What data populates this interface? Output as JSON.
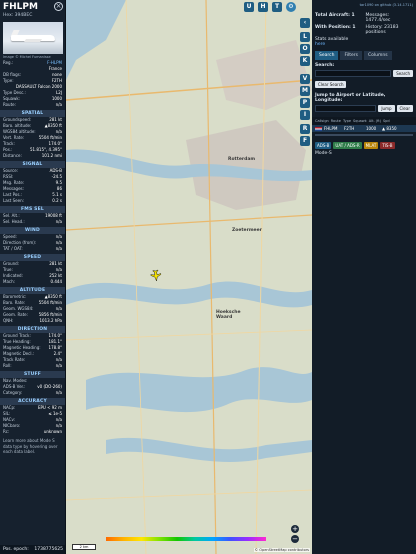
{
  "sidebar": {
    "callsign": "FHLPM",
    "subtitle": "Hex: 394BEC",
    "photo_credit": "Image © Michel Fumanisse",
    "aircraft": [
      {
        "k": "Reg.:",
        "v": "F-HLPM",
        "link": true
      },
      {
        "k": "",
        "v": "France"
      },
      {
        "k": "DB flags:",
        "v": "none"
      },
      {
        "k": "Type:",
        "v": "F2TH"
      },
      {
        "k": "",
        "v": "DASSAULT Falcon 2000"
      },
      {
        "k": "Type Desc.:",
        "v": "L2J"
      },
      {
        "k": "Squawk:",
        "v": "1000"
      },
      {
        "k": "Route:",
        "v": "n/a"
      }
    ],
    "sections": [
      {
        "title": "SPATIAL",
        "rows": [
          {
            "k": "Groundspeed:",
            "v": "281 kt"
          },
          {
            "k": "Baro. altitude:",
            "v": "▲8350 ft"
          },
          {
            "k": "WGS84 altitude:",
            "v": "n/a"
          },
          {
            "k": "Vert. Rate:",
            "v": "5504 ft/min"
          },
          {
            "k": "Track:",
            "v": "174.0°"
          },
          {
            "k": "Pos.:",
            "v": "51.815°, 4.395°"
          },
          {
            "k": "Distance:",
            "v": "101.2 nmi"
          }
        ]
      },
      {
        "title": "SIGNAL",
        "rows": [
          {
            "k": "Source:",
            "v": "ADS-B"
          },
          {
            "k": "RSSI:",
            "v": "-24.5"
          },
          {
            "k": "Msg. Rate:",
            "v": "9.5"
          },
          {
            "k": "Messages:",
            "v": "86"
          },
          {
            "k": "Last Pos.:",
            "v": "5.1 s"
          },
          {
            "k": "Last Seen:",
            "v": "0.2 s"
          }
        ]
      },
      {
        "title": "FMS SEL",
        "rows": [
          {
            "k": "Sel. Alt.:",
            "v": "19008 ft"
          },
          {
            "k": "Sel. Head.:",
            "v": "n/a"
          }
        ]
      },
      {
        "title": "WIND",
        "rows": [
          {
            "k": "Speed:",
            "v": "n/a"
          },
          {
            "k": "Direction (from):",
            "v": "n/a"
          },
          {
            "k": "TAT / OAT:",
            "v": "n/a"
          }
        ]
      },
      {
        "title": "SPEED",
        "rows": [
          {
            "k": "Ground:",
            "v": "281 kt"
          },
          {
            "k": "True:",
            "v": "n/a"
          },
          {
            "k": "Indicated:",
            "v": "252 kt"
          },
          {
            "k": "Mach:",
            "v": "0.444"
          }
        ]
      },
      {
        "title": "ALTITUDE",
        "rows": [
          {
            "k": "Barometric:",
            "v": "▲8350 ft"
          },
          {
            "k": "Baro. Rate:",
            "v": "5504 ft/min"
          },
          {
            "k": "Geom. WGS84:",
            "v": "n/a"
          },
          {
            "k": "Geom. Rate:",
            "v": "5856 ft/min"
          },
          {
            "k": "QNH:",
            "v": "1013.2 hPa"
          }
        ]
      },
      {
        "title": "DIRECTION",
        "rows": [
          {
            "k": "Ground Track:",
            "v": "174.0°"
          },
          {
            "k": "True Heading:",
            "v": "181.1°"
          },
          {
            "k": "Magnetic Heading:",
            "v": "178.8°"
          },
          {
            "k": "Magnetic Decl.:",
            "v": "2.4°"
          },
          {
            "k": "Track Rate:",
            "v": "n/a"
          },
          {
            "k": "Roll:",
            "v": "n/a"
          }
        ]
      },
      {
        "title": "STUFF",
        "rows": [
          {
            "k": "Nav. Modes:",
            "v": ""
          },
          {
            "k": "ADS-B Ver.:",
            "v": "v0 (DO-260)"
          },
          {
            "k": "Category:",
            "v": "n/a"
          }
        ]
      },
      {
        "title": "ACCURACY",
        "rows": [
          {
            "k": "NACp:",
            "v": "EPU < 92 m"
          },
          {
            "k": "SIL:",
            "v": "≤ 1e-5"
          },
          {
            "k": "NACv:",
            "v": "n/a"
          },
          {
            "k": "NICbaro:",
            "v": "n/a"
          },
          {
            "k": "Rc:",
            "v": "unknown"
          }
        ]
      }
    ],
    "note": "Learn more about Mode S data type by hovering over each data label.",
    "epoch_label": "Pos. epoch:",
    "epoch_value": "1738775625"
  },
  "map": {
    "controls_top": [
      "U",
      "H",
      "T"
    ],
    "controls_side": [
      "L",
      "O",
      "K",
      "V",
      "M",
      "P",
      "I",
      "R",
      "F"
    ],
    "places": [
      "Rotterdam",
      "Zoetermeer",
      "Hoeksche Waard",
      "Dordrecht"
    ],
    "scale_label": "2 km",
    "attribution": "© OpenStreetMap contributors",
    "zoom_in": "+",
    "zoom_out": "−"
  },
  "panel": {
    "version_link": "tar1090 on github (3.14.1711)",
    "stats": {
      "total_label": "Total Aircraft: 1",
      "messages_label": "Messages: 1477.4/sec",
      "position_label": "With Position: 1",
      "history_label": "History: 23183 positions"
    },
    "stats_link": "Stats available",
    "stats_link2": "here",
    "tabs": [
      "Search",
      "Filters",
      "Columns"
    ],
    "search_label": "Search:",
    "search_button": "Search",
    "clear_button": "Clear Search",
    "jump_label": "Jump to Airport or Latitude, Longitude:",
    "jump_button": "Jump",
    "jump_clear": "Clear",
    "table_headers": [
      "Callsign",
      "Route",
      "Type",
      "Squawk",
      "Alt. (ft)",
      "Spd"
    ],
    "table_row": {
      "callsign": "FHLPM",
      "type": "F2TH",
      "squawk": "1000",
      "alt": "▲ 8350"
    },
    "badges": [
      "ADS-B",
      "UAT / ADS-R",
      "MLAT",
      "TIS-B"
    ],
    "mode_s": "Mode-S"
  }
}
